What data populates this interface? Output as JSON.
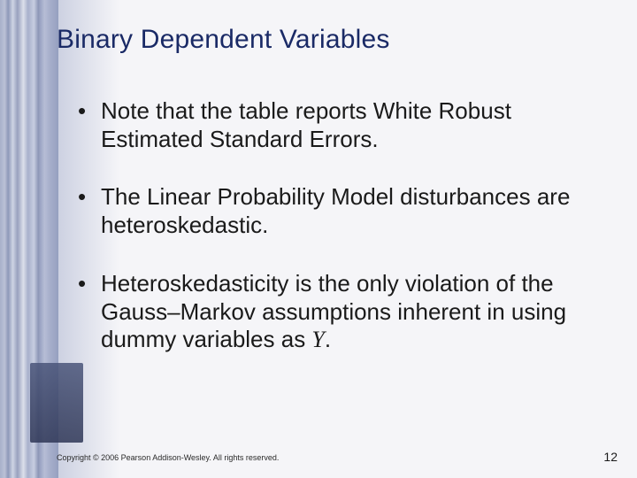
{
  "title": "Binary Dependent Variables",
  "bullets": [
    {
      "text": "Note that the table reports White Robust Estimated Standard Errors."
    },
    {
      "text": "The Linear Probability Model disturbances are heteroskedastic."
    },
    {
      "text_pre": "Heteroskedasticity is the only violation of the Gauss–Markov assumptions inherent in using dummy variables as ",
      "var": "Y",
      "text_post": "."
    }
  ],
  "footer": "Copyright © 2006 Pearson Addison-Wesley. All rights reserved.",
  "page_number": "12"
}
